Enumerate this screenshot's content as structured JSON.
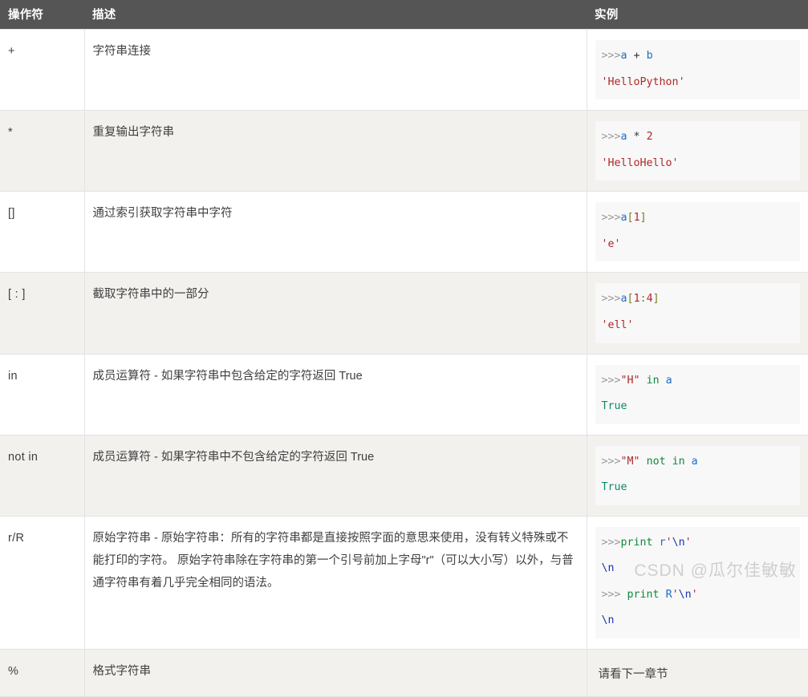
{
  "table": {
    "headers": {
      "operator": "操作符",
      "description": "描述",
      "example": "实例"
    },
    "rows": [
      {
        "operator": "+",
        "description": "字符串连接",
        "code_lines": [
          [
            {
              "t": "prompt",
              "v": ">>>"
            },
            {
              "t": "name",
              "v": "a"
            },
            {
              "t": "op",
              "v": " + "
            },
            {
              "t": "name",
              "v": "b"
            }
          ],
          [
            {
              "t": "str",
              "v": "'HelloPython'"
            }
          ]
        ]
      },
      {
        "operator": "*",
        "description": "重复输出字符串",
        "code_lines": [
          [
            {
              "t": "prompt",
              "v": ">>>"
            },
            {
              "t": "name",
              "v": "a"
            },
            {
              "t": "op",
              "v": " * "
            },
            {
              "t": "num",
              "v": "2"
            }
          ],
          [
            {
              "t": "str",
              "v": "'HelloHello'"
            }
          ]
        ]
      },
      {
        "operator": "[]",
        "description": "通过索引获取字符串中字符",
        "code_lines": [
          [
            {
              "t": "prompt",
              "v": ">>>"
            },
            {
              "t": "name",
              "v": "a"
            },
            {
              "t": "brk",
              "v": "["
            },
            {
              "t": "num",
              "v": "1"
            },
            {
              "t": "brk",
              "v": "]"
            }
          ],
          [
            {
              "t": "str",
              "v": "'e'"
            }
          ]
        ]
      },
      {
        "operator": "[ : ]",
        "description": "截取字符串中的一部分",
        "code_lines": [
          [
            {
              "t": "prompt",
              "v": ">>>"
            },
            {
              "t": "name",
              "v": "a"
            },
            {
              "t": "brk",
              "v": "["
            },
            {
              "t": "num",
              "v": "1"
            },
            {
              "t": "brk",
              "v": ":"
            },
            {
              "t": "num",
              "v": "4"
            },
            {
              "t": "brk",
              "v": "]"
            }
          ],
          [
            {
              "t": "str",
              "v": "'ell'"
            }
          ]
        ]
      },
      {
        "operator": "in",
        "description": "成员运算符 - 如果字符串中包含给定的字符返回 True",
        "code_lines": [
          [
            {
              "t": "prompt",
              "v": ">>>"
            },
            {
              "t": "str",
              "v": "\"H\""
            },
            {
              "t": "kw",
              "v": " in "
            },
            {
              "t": "name",
              "v": "a"
            }
          ],
          [
            {
              "t": "bool",
              "v": "True"
            }
          ]
        ]
      },
      {
        "operator": "not in",
        "description": "成员运算符 - 如果字符串中不包含给定的字符返回 True",
        "code_lines": [
          [
            {
              "t": "prompt",
              "v": ">>>"
            },
            {
              "t": "str",
              "v": "\"M\""
            },
            {
              "t": "kw",
              "v": " not in "
            },
            {
              "t": "name",
              "v": "a"
            }
          ],
          [
            {
              "t": "bool",
              "v": "True"
            }
          ]
        ]
      },
      {
        "operator": "r/R",
        "description": "原始字符串 - 原始字符串：所有的字符串都是直接按照字面的意思来使用，没有转义特殊或不能打印的字符。 原始字符串除在字符串的第一个引号前加上字母\"r\"（可以大小写）以外，与普通字符串有着几乎完全相同的语法。",
        "code_lines": [
          [
            {
              "t": "prompt",
              "v": ">>>"
            },
            {
              "t": "kw",
              "v": "print"
            },
            {
              "t": "op",
              "v": " "
            },
            {
              "t": "pre",
              "v": "r"
            },
            {
              "t": "str",
              "v": "'"
            },
            {
              "t": "esc",
              "v": "\\n"
            },
            {
              "t": "str",
              "v": "'"
            }
          ],
          [
            {
              "t": "out",
              "v": "\\n"
            }
          ],
          [
            {
              "t": "prompt",
              "v": ">>> "
            },
            {
              "t": "kw",
              "v": "print"
            },
            {
              "t": "op",
              "v": " "
            },
            {
              "t": "pre",
              "v": "R"
            },
            {
              "t": "str",
              "v": "'"
            },
            {
              "t": "esc",
              "v": "\\n"
            },
            {
              "t": "str",
              "v": "'"
            }
          ],
          [
            {
              "t": "out",
              "v": "\\n"
            }
          ]
        ]
      },
      {
        "operator": "%",
        "description": "格式字符串",
        "plain_example": "请看下一章节",
        "code_lines": []
      }
    ]
  },
  "watermark": {
    "text": "CSDN @瓜尔佳敏敏"
  },
  "colors": {
    "header_bg": "#555555",
    "header_fg": "#ffffff",
    "row_odd_bg": "#ffffff",
    "row_even_bg": "#f3f1ee",
    "border": "#e3e3e3",
    "code_bg": "#f8f8f8",
    "prompt": "#9a9a9a",
    "name": "#1b6fc4",
    "string": "#b02828",
    "keyword": "#0f8a3c",
    "boolean": "#0f8a6a",
    "bracket": "#7c7a22",
    "escape": "#1b33b0",
    "watermark": "#cfcfcf"
  }
}
